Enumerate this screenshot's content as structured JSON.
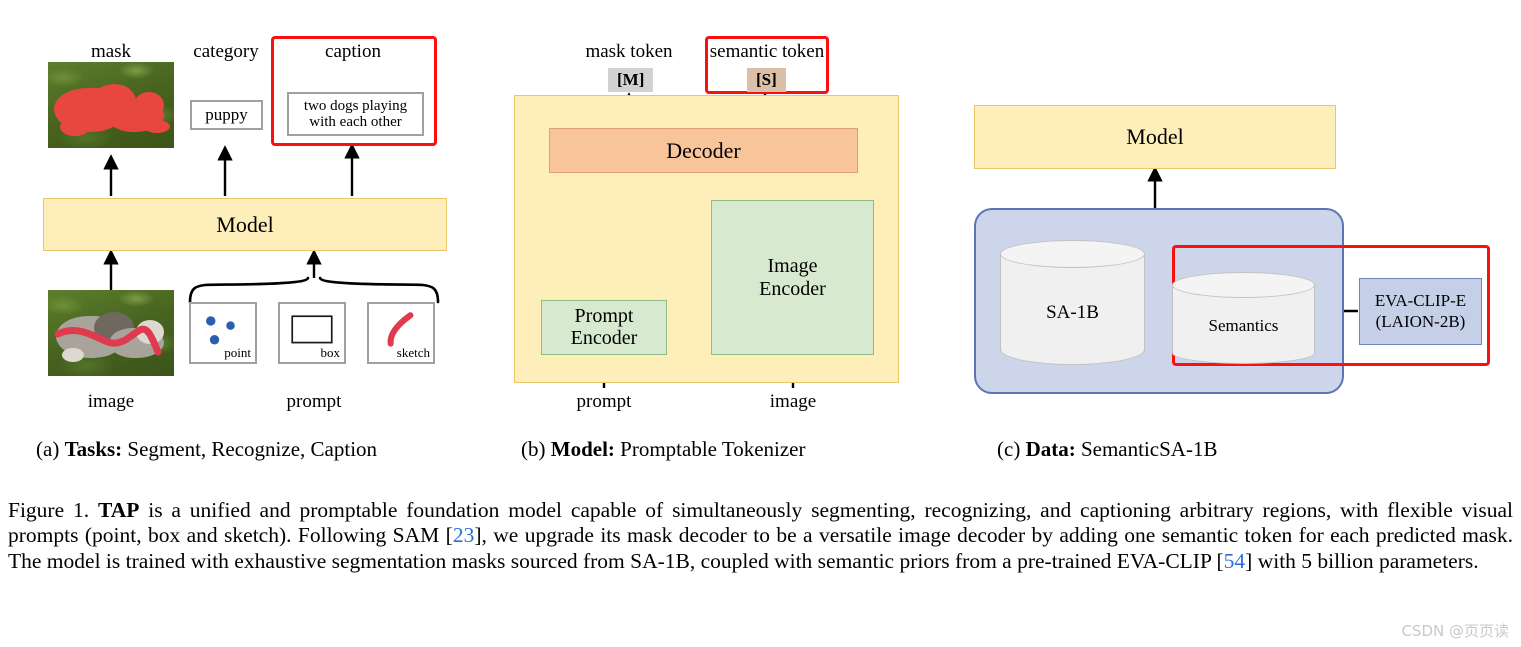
{
  "figure": {
    "panels": [
      {
        "id": "a",
        "caption_prefix": "(a)",
        "caption_bold": "Tasks:",
        "caption_rest": "Segment, Recognize, Caption",
        "outputs": {
          "mask_label": "mask",
          "category_label": "category",
          "caption_label": "caption",
          "category_value": "puppy",
          "caption_value_line1": "two dogs playing",
          "caption_value_line2": "with each other"
        },
        "model_label": "Model",
        "inputs": {
          "image_label": "image",
          "prompt_label": "prompt",
          "prompt_kinds": [
            "point",
            "box",
            "sketch"
          ]
        }
      },
      {
        "id": "b",
        "caption_prefix": "(b)",
        "caption_bold": "Model:",
        "caption_rest": "Promptable Tokenizer",
        "tokens": {
          "mask_token_label": "mask token",
          "mask_token_chip": "[M]",
          "semantic_token_label": "semantic token",
          "semantic_token_chip": "[S]"
        },
        "blocks": {
          "decoder": "Decoder",
          "prompt_encoder_line1": "Prompt",
          "prompt_encoder_line2": "Encoder",
          "image_encoder_line1": "Image",
          "image_encoder_line2": "Encoder"
        },
        "inputs": {
          "prompt_label": "prompt",
          "image_label": "image"
        }
      },
      {
        "id": "c",
        "caption_prefix": "(c)",
        "caption_bold": "Data:",
        "caption_rest": "SemanticSA-1B",
        "model_label": "Model",
        "stores": {
          "sa1b": "SA-1B",
          "semantics": "Semantics"
        },
        "external": {
          "line1": "EVA-CLIP-E",
          "line2": "(LAION-2B)"
        }
      }
    ],
    "caption": {
      "lead": "Figure 1.",
      "bold_term": "TAP",
      "part1": " is a unified and promptable foundation model capable of simultaneously segmenting, recognizing, and captioning arbitrary regions, with flexible visual prompts (point, box and sketch). Following SAM [",
      "cite1": "23",
      "part2": "], we upgrade its mask decoder to be a versatile image decoder by adding one semantic token for each predicted mask. The model is trained with exhaustive segmentation masks sourced from SA-1B, coupled with semantic priors from a pre-trained EVA-CLIP [",
      "cite2": "54",
      "part3": "] with 5 billion parameters."
    },
    "watermark": "CSDN @页页读",
    "colors": {
      "model_fill": "#fdeeba",
      "model_border": "#e8c86b",
      "decoder_fill": "#f8c49a",
      "decoder_border": "#e0a071",
      "encoder_fill": "#d7ead0",
      "encoder_border": "#8fbd85",
      "highlight_red": "#fb0f0f",
      "data_pane_fill": "#ccd5ea",
      "data_pane_border": "#5b75b4",
      "eva_fill": "#c5cfe8",
      "cite_blue": "#2a6fd6",
      "mask_red": "#e8473f",
      "point_blue": "#2a5fb0",
      "sketch_red": "#e03a4e"
    }
  }
}
